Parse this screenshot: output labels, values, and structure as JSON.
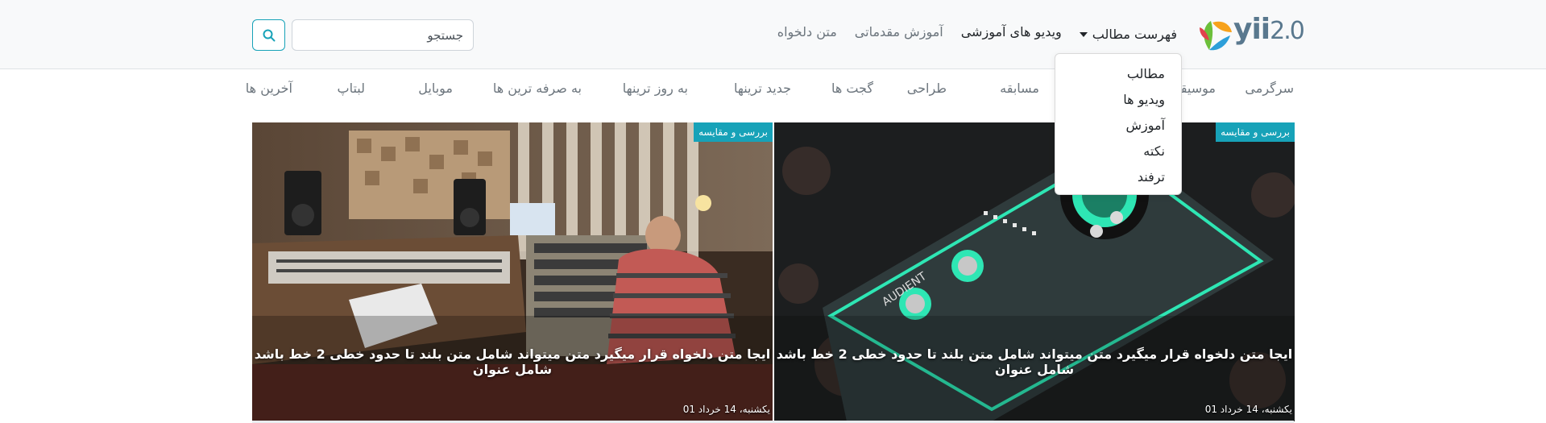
{
  "brand": {
    "logo_text": "yii",
    "version": "2.0"
  },
  "nav": {
    "dropdown_label": "فهرست مطالب",
    "items": [
      "ویدیو های آموزشی",
      "آموزش مقدماتی",
      "متن دلخواه"
    ]
  },
  "dropdown_menu": {
    "items": [
      "مطالب",
      "ویدیو ها",
      "آموزش",
      "نکته",
      "ترفند"
    ]
  },
  "search": {
    "placeholder": "جستجو",
    "icon": "search-icon"
  },
  "categories": [
    "سرگرمی",
    "موسیقی",
    "مسابقه",
    "طراحی",
    "گجت ها",
    "جدید ترینها",
    "به روز ترینها",
    "به صرفه ترین ها",
    "موبایل",
    "لبتاپ",
    "آخرین ها"
  ],
  "cards": [
    {
      "badge": "بررسی و مقایسه",
      "title": "ایجا متن دلخواه قرار میگیرد متن میتواند شامل متن بلند تا حدود خطی 2 خط باشد شامل عنوان",
      "date": "یکشنبه، 14 خرداد 01"
    },
    {
      "badge": "بررسی و مقایسه",
      "title": "ایجا متن دلخواه قرار میگیرد متن میتواند شامل متن بلند تا حدود خطی 2 خط باشد شامل عنوان",
      "date": "یکشنبه، 14 خرداد 01"
    }
  ],
  "colors": {
    "accent": "#17a2b8",
    "navbar_bg": "#f8f9fa",
    "logo": "#59788e"
  }
}
